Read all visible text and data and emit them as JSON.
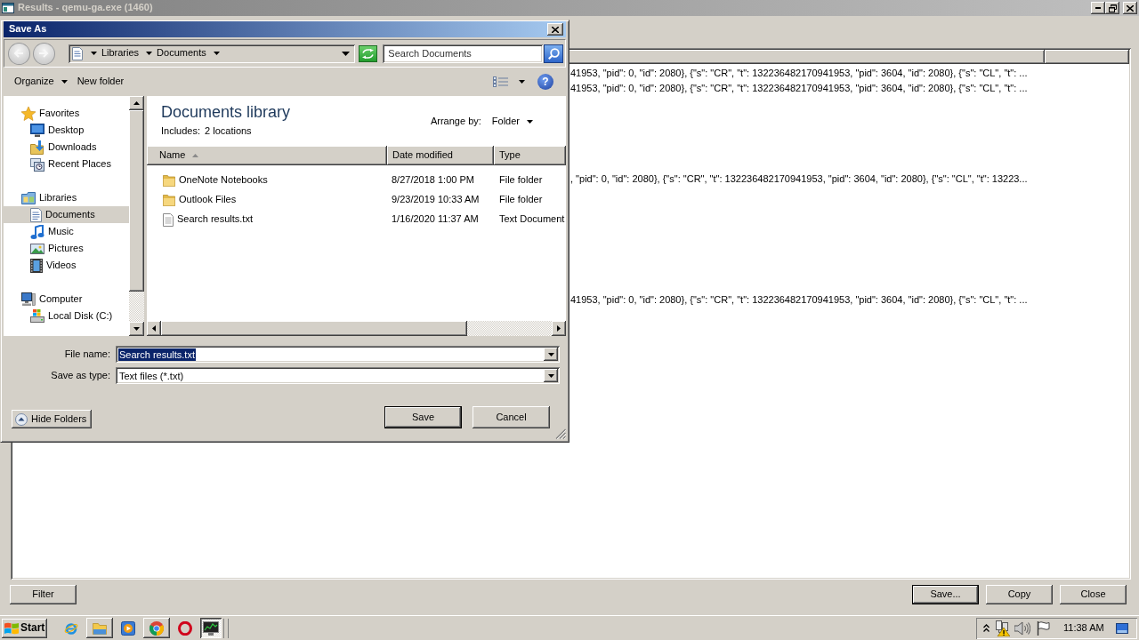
{
  "results_window": {
    "title": "Results - qemu-ga.exe (1460)",
    "active": false,
    "rows": [
      {
        "text": "41953, \"pid\": 0, \"id\": 2080}, {\"s\": \"CR\", \"t\": 132236482170941953, \"pid\": 3604, \"id\": 2080}, {\"s\": \"CL\", \"t\": ..."
      },
      {
        "text": "41953, \"pid\": 0, \"id\": 2080}, {\"s\": \"CR\", \"t\": 132236482170941953, \"pid\": 3604, \"id\": 2080}, {\"s\": \"CL\", \"t\": ..."
      },
      {
        "text": ", \"pid\": 0, \"id\": 2080}, {\"s\": \"CR\", \"t\": 132236482170941953, \"pid\": 3604, \"id\": 2080}, {\"s\": \"CL\", \"t\": 13223..."
      },
      {
        "text": "41953, \"pid\": 0, \"id\": 2080}, {\"s\": \"CR\", \"t\": 132236482170941953, \"pid\": 3604, \"id\": 2080}, {\"s\": \"CL\", \"t\": ..."
      }
    ],
    "filter_button": {
      "label": "Filter"
    },
    "buttons": [
      {
        "label": "Save...",
        "default": true
      },
      {
        "label": "Copy",
        "default": false
      },
      {
        "label": "Close",
        "default": false
      }
    ]
  },
  "dialog": {
    "title": "Save As",
    "active": true,
    "breadcrumbs": [
      "Libraries",
      "Documents"
    ],
    "search": {
      "placeholder": "Search Documents"
    },
    "commands": [
      {
        "label": "Organize",
        "dropdown": true
      },
      {
        "label": "New folder",
        "dropdown": false
      }
    ],
    "help_button": "?",
    "nav": [
      {
        "label": "Favorites",
        "kind": "favorites",
        "selected": false,
        "children": [
          {
            "label": "Desktop",
            "kind": "desktop",
            "selected": false
          },
          {
            "label": "Downloads",
            "kind": "downloads",
            "selected": false
          },
          {
            "label": "Recent Places",
            "kind": "recent",
            "selected": false
          }
        ]
      },
      {
        "label": "Libraries",
        "kind": "libraries",
        "selected": false,
        "children": [
          {
            "label": "Documents",
            "kind": "documents",
            "selected": true
          },
          {
            "label": "Music",
            "kind": "music",
            "selected": false
          },
          {
            "label": "Pictures",
            "kind": "pictures",
            "selected": false
          },
          {
            "label": "Videos",
            "kind": "videos",
            "selected": false
          }
        ]
      },
      {
        "label": "Computer",
        "kind": "computer",
        "selected": false,
        "children": [
          {
            "label": "Local Disk (C:)",
            "kind": "disk",
            "selected": false
          }
        ]
      }
    ],
    "library": {
      "title": "Documents library",
      "includes_label": "Includes:",
      "includes_value": "2 locations",
      "arrange_label": "Arrange by:",
      "arrange_value": "Folder"
    },
    "columns": [
      {
        "label": "Name",
        "sorted": true
      },
      {
        "label": "Date modified",
        "sorted": false
      },
      {
        "label": "Type",
        "sorted": false
      }
    ],
    "files": [
      {
        "name": "OneNote Notebooks",
        "date": "8/27/2018 1:00 PM",
        "type": "File folder",
        "kind": "folder",
        "selected": false
      },
      {
        "name": "Outlook Files",
        "date": "9/23/2019 10:33 AM",
        "type": "File folder",
        "kind": "folder",
        "selected": false
      },
      {
        "name": "Search results.txt",
        "date": "1/16/2020 11:37 AM",
        "type": "Text Document",
        "kind": "text",
        "selected": false
      }
    ],
    "file_name": {
      "label": "File name:",
      "value": "Search results.txt",
      "selected": true
    },
    "save_type": {
      "label": "Save as type:",
      "value": "Text files (*.txt)"
    },
    "hide_folders": {
      "label": "Hide Folders"
    },
    "buttons": [
      {
        "label": "Save",
        "default": true
      },
      {
        "label": "Cancel",
        "default": false
      }
    ]
  },
  "taskbar": {
    "start": "Start",
    "apps": [
      {
        "kind": "e-browser",
        "open": false,
        "selected": false
      },
      {
        "kind": "file-manager",
        "open": true,
        "selected": false
      },
      {
        "kind": "media-player",
        "open": false,
        "selected": false
      },
      {
        "kind": "web-browser",
        "open": true,
        "selected": false
      },
      {
        "kind": "o-browser",
        "open": false,
        "selected": false
      },
      {
        "kind": "task-monitor",
        "open": true,
        "selected": true
      }
    ],
    "clock": "11:38 AM"
  }
}
